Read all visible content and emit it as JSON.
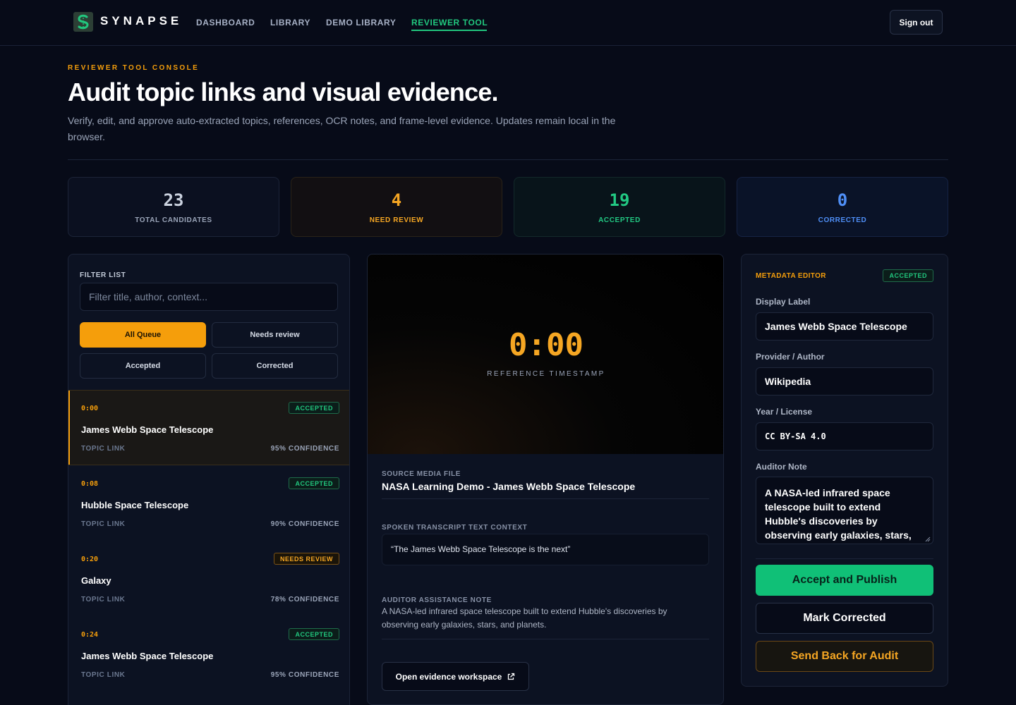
{
  "nav": {
    "brand": "SYNAPSE",
    "links": [
      {
        "label": "DASHBOARD"
      },
      {
        "label": "LIBRARY"
      },
      {
        "label": "DEMO LIBRARY"
      },
      {
        "label": "REVIEWER TOOL"
      }
    ],
    "active_link": "REVIEWER TOOL",
    "signout_label": "Sign out"
  },
  "header": {
    "eyebrow": "REVIEWER TOOL CONSOLE",
    "title": "Audit topic links and visual evidence.",
    "description": "Verify, edit, and approve auto-extracted topics, references, OCR notes, and frame-level evidence. Updates remain local in the browser."
  },
  "stats": [
    {
      "value": "23",
      "label": "TOTAL CANDIDATES"
    },
    {
      "value": "4",
      "label": "NEED REVIEW"
    },
    {
      "value": "19",
      "label": "ACCEPTED"
    },
    {
      "value": "0",
      "label": "CORRECTED"
    }
  ],
  "filter": {
    "label": "FILTER LIST",
    "placeholder": "Filter title, author, context...",
    "value": "",
    "buttons": [
      {
        "label": "All Queue"
      },
      {
        "label": "Needs review"
      },
      {
        "label": "Accepted"
      },
      {
        "label": "Corrected"
      }
    ],
    "active": "All Queue"
  },
  "queue": [
    {
      "time": "0:00",
      "status": "ACCEPTED",
      "title": "James Webb Space Telescope",
      "type": "TOPIC LINK",
      "confidence": "95% CONFIDENCE"
    },
    {
      "time": "0:08",
      "status": "ACCEPTED",
      "title": "Hubble Space Telescope",
      "type": "TOPIC LINK",
      "confidence": "90% CONFIDENCE"
    },
    {
      "time": "0:20",
      "status": "NEEDS REVIEW",
      "title": "Galaxy",
      "type": "TOPIC LINK",
      "confidence": "78% CONFIDENCE"
    },
    {
      "time": "0:24",
      "status": "ACCEPTED",
      "title": "James Webb Space Telescope",
      "type": "TOPIC LINK",
      "confidence": "95% CONFIDENCE"
    }
  ],
  "player": {
    "timestamp": "0:00",
    "caption": "REFERENCE TIMESTAMP"
  },
  "details": {
    "media_label": "SOURCE MEDIA FILE",
    "media_name": "NASA Learning Demo - James Webb Space Telescope",
    "transcript_label": "SPOKEN TRANSCRIPT TEXT CONTEXT",
    "transcript": "“The James Webb Space Telescope is the next”",
    "note_label": "AUDITOR ASSISTANCE NOTE",
    "note": "A NASA-led infrared space telescope built to extend Hubble's discoveries by observing early galaxies, stars, and planets.",
    "evidence_button": "Open evidence workspace"
  },
  "metadata": {
    "title": "METADATA EDITOR",
    "status": "ACCEPTED",
    "display_label_label": "Display Label",
    "display_label": "James Webb Space Telescope",
    "provider_label": "Provider / Author",
    "provider": "Wikipedia",
    "license_label": "Year / License",
    "license": "CC BY-SA 4.0",
    "note_label": "Auditor Note",
    "note": "A NASA-led infrared space telescope built to extend Hubble's discoveries by observing early galaxies, stars, and planets.",
    "accept_button": "Accept and Publish",
    "corrected_button": "Mark Corrected",
    "sendback_button": "Send Back for Audit"
  },
  "colors": {
    "accent_orange": "#f59e0b",
    "accent_green": "#21c77e",
    "accent_blue": "#4f8ff7",
    "background": "#070b18"
  },
  "icons": [
    "synapse-logo-icon",
    "external-link-icon",
    "resize-grip-icon"
  ]
}
